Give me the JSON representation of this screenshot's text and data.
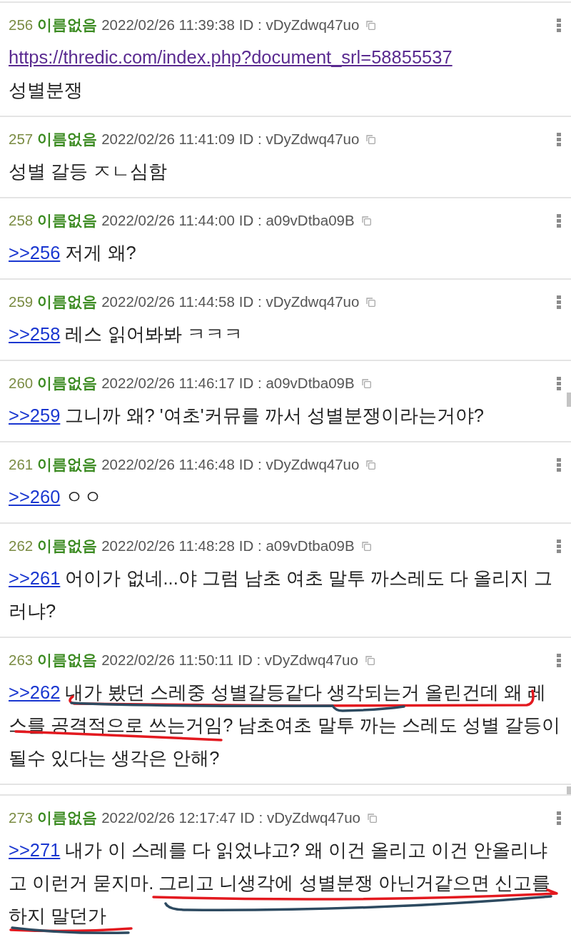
{
  "posts": [
    {
      "number": "256",
      "name": "이름없음",
      "timestamp": "2022/02/26 11:39:38",
      "user_id": "ID : vDyZdwq47uo",
      "link": {
        "text": "https://thredic.com/index.php?document_srl=58855537",
        "visited": true
      },
      "text": "성별분쟁"
    },
    {
      "number": "257",
      "name": "이름없음",
      "timestamp": "2022/02/26 11:41:09",
      "user_id": "ID : vDyZdwq47uo",
      "text": "성별 갈등 ㅈㄴ심함"
    },
    {
      "number": "258",
      "name": "이름없음",
      "timestamp": "2022/02/26 11:44:00",
      "user_id": "ID : a09vDtba09B",
      "reply_to": {
        "text": ">>256",
        "visited": false
      },
      "text": "저게 왜?"
    },
    {
      "number": "259",
      "name": "이름없음",
      "timestamp": "2022/02/26 11:44:58",
      "user_id": "ID : vDyZdwq47uo",
      "reply_to": {
        "text": ">>258",
        "visited": false
      },
      "text": "레스 읽어봐봐 ㅋㅋㅋ"
    },
    {
      "number": "260",
      "name": "이름없음",
      "timestamp": "2022/02/26 11:46:17",
      "user_id": "ID : a09vDtba09B",
      "reply_to": {
        "text": ">>259",
        "visited": false
      },
      "text": "그니까 왜? '여초'커뮤를 까서 성별분쟁이라는거야?"
    },
    {
      "number": "261",
      "name": "이름없음",
      "timestamp": "2022/02/26 11:46:48",
      "user_id": "ID : vDyZdwq47uo",
      "reply_to": {
        "text": ">>260",
        "visited": false
      },
      "text": "ㅇㅇ"
    },
    {
      "number": "262",
      "name": "이름없음",
      "timestamp": "2022/02/26 11:48:28",
      "user_id": "ID : a09vDtba09B",
      "reply_to": {
        "text": ">>261",
        "visited": false
      },
      "text": "어이가 없네...야 그럼 남초 여초 말투 까스레도 다 올리지 그러냐?"
    },
    {
      "number": "263",
      "name": "이름없음",
      "timestamp": "2022/02/26 11:50:11",
      "user_id": "ID : vDyZdwq47uo",
      "reply_to": {
        "text": ">>262",
        "visited": false
      },
      "text": "내가 봤던 스레중 성별갈등같다 생각되는거 올린건데 왜 레스를 공격적으로 쓰는거임? 남초여초 말투 까는 스레도 성별 갈등이 될수 있다는 생각은 안해?",
      "annotations": [
        {
          "color": "#e3191f"
        },
        {
          "color": "#2d4a60"
        },
        {
          "color": "#e3191f"
        }
      ]
    },
    {
      "number": "273",
      "name": "이름없음",
      "timestamp": "2022/02/26 12:17:47",
      "user_id": "ID : vDyZdwq47uo",
      "gap_before": true,
      "reply_to": {
        "text": ">>271",
        "visited": false
      },
      "text": "내가 이 스레를 다 읽었냐고? 왜 이건 올리고 이건 안올리냐고 이런거 묻지마. 그리고 니생각에 성별분쟁 아닌거같으면 신고를 하지 말던가",
      "annotations": [
        {
          "color": "#e3191f"
        },
        {
          "color": "#2d4a60"
        },
        {
          "color": "#e3191f"
        },
        {
          "color": "#2d4a60"
        }
      ]
    }
  ]
}
